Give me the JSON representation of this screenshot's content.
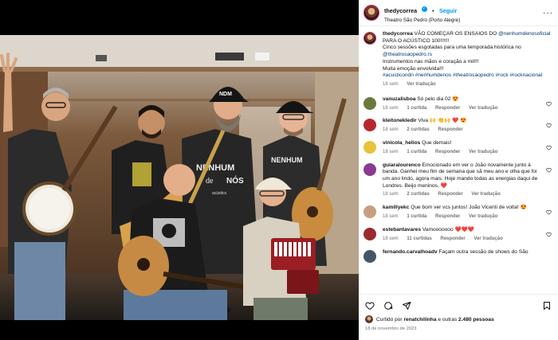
{
  "header": {
    "username": "thedycorrea",
    "verified_mark": "✓",
    "separator": "•",
    "follow_label": "Seguir",
    "location": "Theatro São Pedro (Porto Alegre)",
    "more_label": "···"
  },
  "caption": {
    "username": "thedycorrea",
    "line1_a": "VÃO COMEÇAR OS ENSAIOS DO ",
    "line1_tag": "@nenhumdenosoficial",
    "line1_b": " PARA O ACÚSTICO 100!!!!!!",
    "line2_a": "Cinco sessões esgotadas para uma temporada histórica no ",
    "line2_tag": "@theatrosaopedro.rs",
    "line3": "Instrumentos nas mãos e coração a mil!!!",
    "line4": "Muita emoção envolvida!!!",
    "hashtags": "#acusticondn #nenhumdenos #theatrosaopedro #rock #rocknacional",
    "time": "18 sem",
    "translate": "Ver tradução"
  },
  "comments": [
    {
      "username": "vanuzalisboa",
      "text": "Só pelo dia 02 😍",
      "time": "18 sem",
      "likes": "1 curtida",
      "reply": "Responder",
      "translate": "Ver tradução",
      "avatar_color": "#6b7a3c"
    },
    {
      "username": "kleitonekledir",
      "text": "Viva 🙌 👏🙌 ❤️ 😍",
      "time": "18 sem",
      "likes": "2 curtidas",
      "reply": "Responder",
      "translate": "",
      "avatar_color": "#b8262e"
    },
    {
      "username": "vinicola_helios",
      "text": "Que demais!",
      "time": "18 sem",
      "likes": "1 curtida",
      "reply": "Responder",
      "translate": "Ver tradução",
      "avatar_color": "#e8c23a"
    },
    {
      "username": "guiaralourenco",
      "text": "Emocionado em ver o João novamente junto à banda. Ganhei meu fim de semana que sã meu ano e olha que foi um ano lindo, agora mais. Hoje mando todas as energias daqui de Londres. Beijo meninos. ❤️",
      "time": "18 sem",
      "likes": "2 curtidas",
      "reply": "Responder",
      "translate": "Ver tradução",
      "avatar_color": "#8c3a8f"
    },
    {
      "username": "kamillyekc",
      "text": "Que bom ver vcs juntos! João Vicenti de volta! 😍",
      "time": "18 sem",
      "likes": "1 curtida",
      "reply": "Responder",
      "translate": "Ver tradução",
      "avatar_color": "#c99e7e"
    },
    {
      "username": "estebantavares",
      "text": "Vamooooooo ❤️❤️❤️",
      "time": "18 sem",
      "likes": "11 curtidas",
      "reply": "Responder",
      "translate": "Ver tradução",
      "avatar_color": "#9a2a30"
    },
    {
      "username": "fernando.carvalhoadv",
      "text": "Façam outra sessão de shows do São",
      "time": "",
      "likes": "",
      "reply": "",
      "translate": "",
      "avatar_color": "#445566"
    }
  ],
  "footer": {
    "liked_prefix": "Curtido por ",
    "liked_user": "renatchilinha",
    "liked_suffix": " e outras ",
    "liked_count": "2.480 pessoas",
    "date": "18 de novembro de 2023"
  },
  "photo": {
    "shirt_text_1": "NDM",
    "shirt_text_2": "NENHUM",
    "shirt_text_3": "de",
    "shirt_text_4": "NÓS",
    "shirt_text_5": "acústico",
    "shirt_text_6": "NENHUM"
  },
  "colors": {
    "accent": "#0095f6",
    "heart": "#ed4956",
    "tag": "#00376b",
    "muted": "#737373"
  }
}
